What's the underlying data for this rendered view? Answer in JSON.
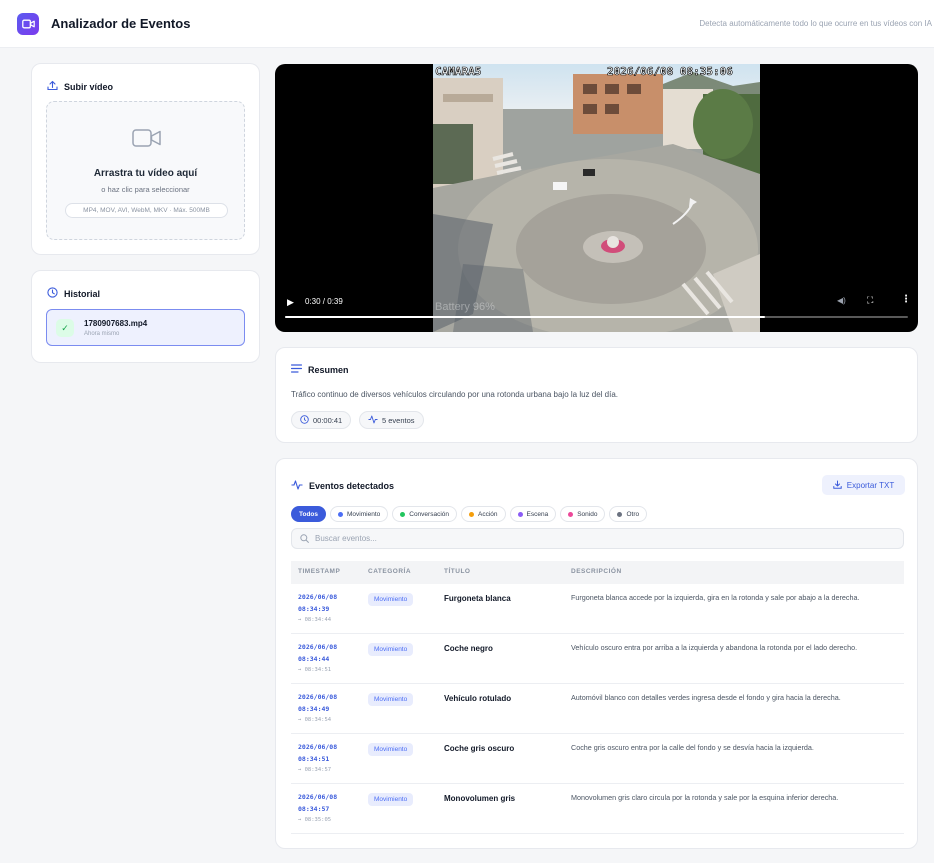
{
  "header": {
    "title": "Analizador de Eventos",
    "tagline": "Detecta automáticamente todo lo que ocurre en tus vídeos con IA"
  },
  "upload": {
    "title": "Subir vídeo",
    "drop_title": "Arrastra tu vídeo aquí",
    "drop_sub": "o haz clic para seleccionar",
    "formats": "MP4, MOV, AVI, WebM, MKV · Máx. 500MB"
  },
  "history": {
    "title": "Historial",
    "items": [
      {
        "name": "1780907683.mp4",
        "time": "Ahora mismo"
      }
    ]
  },
  "video": {
    "osd_camera": "CAMARA5",
    "osd_datetime": "2026/06/08  08:35:06",
    "osd_battery": "Battery 96%",
    "time": "0:30 / 0:39",
    "progress": 0.77
  },
  "summary": {
    "title": "Resumen",
    "text": "Tráfico continuo de diversos vehículos circulando por una rotonda urbana bajo la luz del día.",
    "duration": "00:00:41",
    "events_count": "5 eventos"
  },
  "events": {
    "title": "Eventos detectados",
    "export_label": "Exportar TXT",
    "search_placeholder": "Buscar eventos...",
    "filters": [
      {
        "label": "Todos",
        "active": true,
        "color": ""
      },
      {
        "label": "Movimiento",
        "active": false,
        "color": "#4c6ef5"
      },
      {
        "label": "Conversación",
        "active": false,
        "color": "#22c55e"
      },
      {
        "label": "Acción",
        "active": false,
        "color": "#f59e0b"
      },
      {
        "label": "Escena",
        "active": false,
        "color": "#8b5cf6"
      },
      {
        "label": "Sonido",
        "active": false,
        "color": "#ec4899"
      },
      {
        "label": "Otro",
        "active": false,
        "color": "#6b7280"
      }
    ],
    "columns": [
      "TIMESTAMP",
      "CATEGORÍA",
      "TÍTULO",
      "DESCRIPCIÓN"
    ],
    "rows": [
      {
        "date": "2026/06/08",
        "start": "08:34:39",
        "end": "→ 08:34:44",
        "category": "Movimiento",
        "title": "Furgoneta blanca",
        "description": "Furgoneta blanca accede por la izquierda, gira en la rotonda y sale por abajo a la derecha."
      },
      {
        "date": "2026/06/08",
        "start": "08:34:44",
        "end": "→ 08:34:51",
        "category": "Movimiento",
        "title": "Coche negro",
        "description": "Vehículo oscuro entra por arriba a la izquierda y abandona la rotonda por el lado derecho."
      },
      {
        "date": "2026/06/08",
        "start": "08:34:49",
        "end": "→ 08:34:54",
        "category": "Movimiento",
        "title": "Vehículo rotulado",
        "description": "Automóvil blanco con detalles verdes ingresa desde el fondo y gira hacia la derecha."
      },
      {
        "date": "2026/06/08",
        "start": "08:34:51",
        "end": "→ 08:34:57",
        "category": "Movimiento",
        "title": "Coche gris oscuro",
        "description": "Coche gris oscuro entra por la calle del fondo y se desvía hacia la izquierda."
      },
      {
        "date": "2026/06/08",
        "start": "08:34:57",
        "end": "→ 08:35:05",
        "category": "Movimiento",
        "title": "Monovolumen gris",
        "description": "Monovolumen gris claro circula por la rotonda y sale por la esquina inferior derecha."
      }
    ]
  }
}
